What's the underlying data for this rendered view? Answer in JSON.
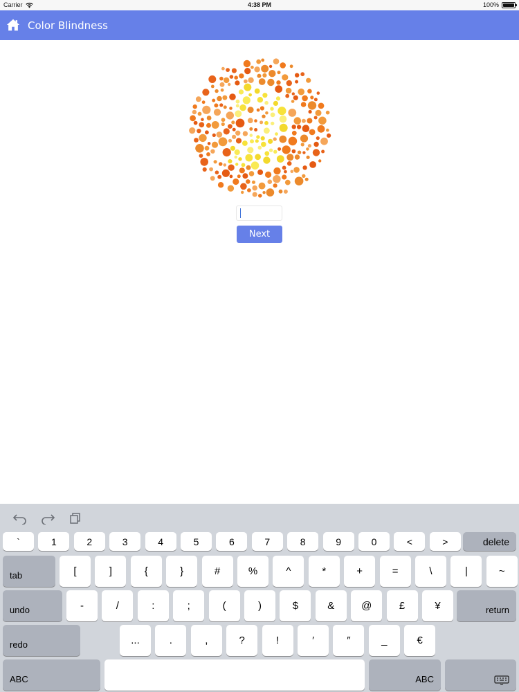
{
  "status_bar": {
    "carrier": "Carrier",
    "time": "4:38 PM",
    "battery": "100%"
  },
  "navbar": {
    "title": "Color Blindness",
    "home_icon": "home-icon"
  },
  "test": {
    "plate_number": "2",
    "answer_value": "",
    "next_label": "Next"
  },
  "colors": {
    "accent": "#6680e8",
    "orange": "#f07a1e",
    "yellow": "#f7e23a"
  },
  "keyboard": {
    "row1": [
      "`",
      "1",
      "2",
      "3",
      "4",
      "5",
      "6",
      "7",
      "8",
      "9",
      "0",
      "<",
      ">"
    ],
    "row1_end": "delete",
    "row2_start": "tab",
    "row2": [
      "[",
      "]",
      "{",
      "}",
      "#",
      "%",
      "^",
      "*",
      "+",
      "=",
      "\\",
      "|",
      "~"
    ],
    "row3_start": "undo",
    "row3": [
      "-",
      "/",
      ":",
      ";",
      "(",
      ")",
      "$",
      "&",
      "@",
      "£",
      "¥"
    ],
    "row3_end": "return",
    "row4_start": "redo",
    "row4": [
      "...",
      ".",
      ",",
      "?",
      "!",
      "′",
      "″",
      "_",
      "€"
    ],
    "row5_left": "ABC",
    "row5_right": "ABC"
  }
}
